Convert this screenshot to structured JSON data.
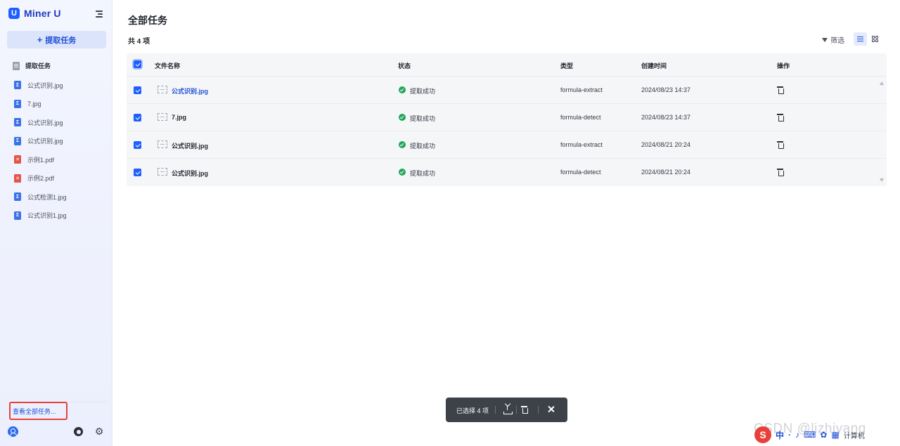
{
  "app": {
    "brand": "Miner U",
    "logo_letter": "U"
  },
  "sidebar": {
    "new_task_label": "提取任务",
    "section_label": "提取任务",
    "files": [
      {
        "name": "公式识别.jpg",
        "kind": "formula",
        "color": "#3a72e8"
      },
      {
        "name": "7.jpg",
        "kind": "formula",
        "color": "#3a72e8"
      },
      {
        "name": "公式识别.jpg",
        "kind": "formula",
        "color": "#3a72e8"
      },
      {
        "name": "公式识别.jpg",
        "kind": "formula",
        "color": "#3a72e8"
      },
      {
        "name": "示例1.pdf",
        "kind": "pdf",
        "color": "#e55349"
      },
      {
        "name": "示例2.pdf",
        "kind": "pdf",
        "color": "#e55349"
      },
      {
        "name": "公式检测1.jpg",
        "kind": "formula",
        "color": "#3a72e8"
      },
      {
        "name": "公式识别1.jpg",
        "kind": "formula",
        "color": "#3a72e8"
      }
    ],
    "view_all_label": "查看全部任务..."
  },
  "main": {
    "title": "全部任务",
    "count_label": "共 4 项",
    "filter_label": "筛选",
    "columns": {
      "name": "文件名称",
      "status": "状态",
      "type": "类型",
      "created": "创建时间",
      "actions": "操作"
    },
    "rows": [
      {
        "name": "公式识别.jpg",
        "status": "提取成功",
        "type": "formula-extract",
        "created": "2024/08/23 14:37",
        "checked": true,
        "is_link": true
      },
      {
        "name": "7.jpg",
        "status": "提取成功",
        "type": "formula-detect",
        "created": "2024/08/23 14:37",
        "checked": true,
        "is_link": false
      },
      {
        "name": "公式识别.jpg",
        "status": "提取成功",
        "type": "formula-extract",
        "created": "2024/08/21 20:24",
        "checked": true,
        "is_link": false
      },
      {
        "name": "公式识别.jpg",
        "status": "提取成功",
        "type": "formula-detect",
        "created": "2024/08/21 20:24",
        "checked": true,
        "is_link": false
      }
    ]
  },
  "selection_bar": {
    "label": "已选择 4 项"
  },
  "watermark": "CSDN @lizhiyang",
  "ime": {
    "logo": "S",
    "mode": "中",
    "tray_text": "计算机"
  },
  "colors": {
    "accent": "#1f5eff",
    "success": "#23a55a",
    "highlight": "#e8403a",
    "selbar": "#3d4148"
  }
}
